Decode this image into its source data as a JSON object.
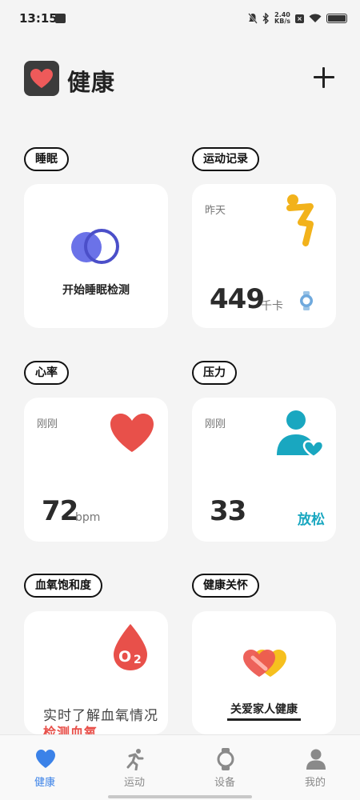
{
  "status_bar": {
    "time": "13:15",
    "speed_value": "2.40",
    "speed_unit": "KB/s",
    "battery_level": 1.0
  },
  "header": {
    "title": "健康"
  },
  "sections": {
    "sleep": {
      "title": "睡眠",
      "action": "开始睡眠检测"
    },
    "exercise": {
      "title": "运动记录",
      "time": "昨天",
      "value": "449",
      "unit": "千卡"
    },
    "heart_rate": {
      "title": "心率",
      "time": "刚刚",
      "value": "72",
      "unit": "bpm"
    },
    "stress": {
      "title": "压力",
      "time": "刚刚",
      "value": "33",
      "status": "放松"
    },
    "spo2": {
      "title": "血氧饱和度",
      "description": "实时了解血氧情况",
      "link": "检测血氧"
    },
    "care": {
      "title": "健康关怀",
      "action": "关爱家人健康"
    }
  },
  "tabs": [
    {
      "label": "健康",
      "icon": "heart-icon",
      "active": true
    },
    {
      "label": "运动",
      "icon": "running-icon",
      "active": false
    },
    {
      "label": "设备",
      "icon": "watch-icon",
      "active": false
    },
    {
      "label": "我的",
      "icon": "person-icon",
      "active": false
    }
  ],
  "colors": {
    "accent": "#3b82e8",
    "heart": "#e8504a",
    "exercise": "#f2b21b",
    "stress": "#19a7c0",
    "sleep": "#5b63e6"
  }
}
